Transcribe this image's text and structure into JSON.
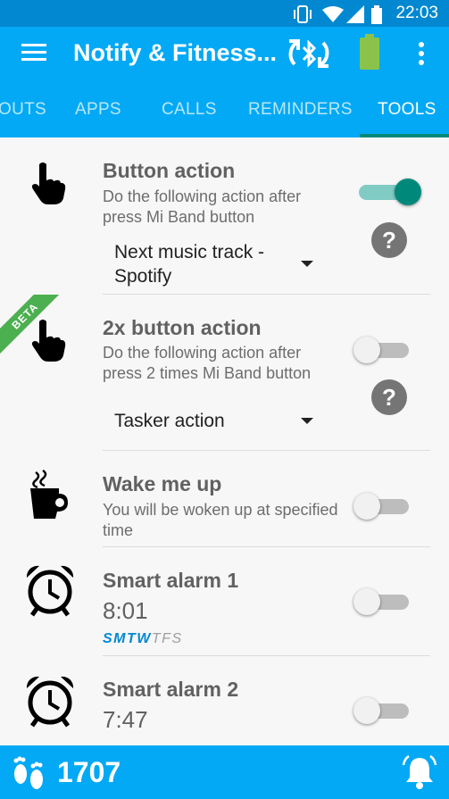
{
  "status_bar": {
    "time": "22:03"
  },
  "app_bar": {
    "title": "Notify & Fitness..."
  },
  "tabs": [
    "OUTS",
    "APPS",
    "CALLS",
    "REMINDERS",
    "TOOLS"
  ],
  "active_tab": "TOOLS",
  "rows": {
    "button_action": {
      "title": "Button action",
      "description": "Do the following action after press Mi Band button",
      "selected_action": "Next music track - Spotify",
      "enabled": true,
      "help": "?"
    },
    "double_button_action": {
      "badge": "BETA",
      "title": "2x button action",
      "description": "Do the following action after press 2 times Mi Band button",
      "selected_action": "Tasker action",
      "enabled": false,
      "help": "?"
    },
    "wake_me_up": {
      "title": "Wake me up",
      "description": "You will be woken up at specified time",
      "enabled": false
    },
    "smart_alarm_1": {
      "title": "Smart alarm 1",
      "time": "8:01",
      "days": [
        "S",
        "M",
        "T",
        "W",
        "T",
        "F",
        "S"
      ],
      "active_days": [
        true,
        true,
        true,
        true,
        false,
        false,
        false
      ],
      "enabled": false
    },
    "smart_alarm_2": {
      "title": "Smart alarm 2",
      "time": "7:47",
      "enabled": false
    }
  },
  "bottom_bar": {
    "steps": "1707"
  },
  "colors": {
    "primary": "#03a9f4",
    "status_bar": "#0288d1",
    "accent": "#00897b",
    "beta": "#4caf50"
  }
}
